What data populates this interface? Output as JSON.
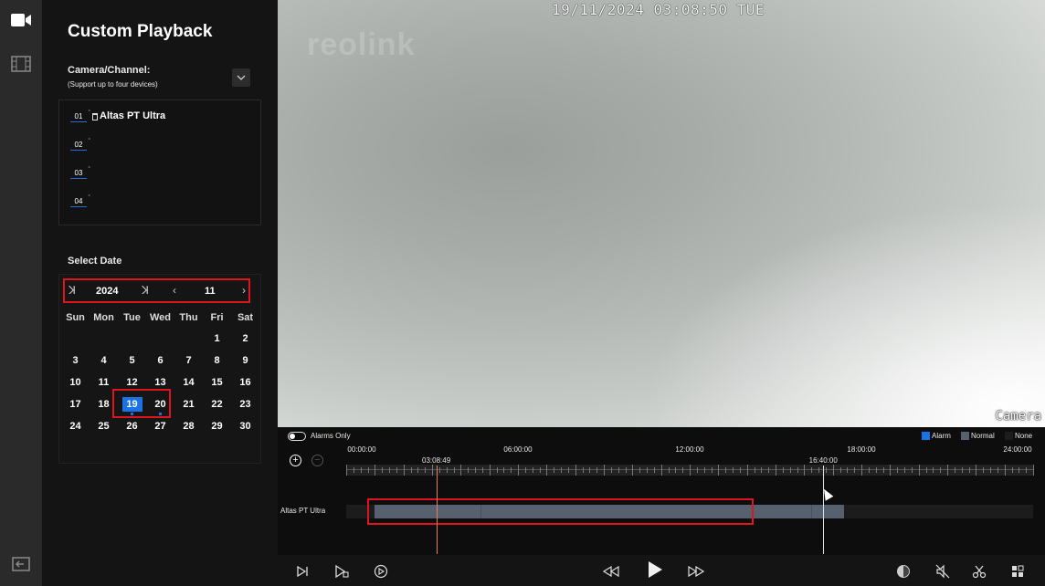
{
  "panel": {
    "title": "Custom Playback",
    "camera_label": "Camera/Channel:",
    "camera_sublabel": "(Support up to four devices)",
    "channels": [
      {
        "num": "01",
        "name": "Altas PT Ultra"
      },
      {
        "num": "02",
        "name": ""
      },
      {
        "num": "03",
        "name": ""
      },
      {
        "num": "04",
        "name": ""
      }
    ],
    "date_label": "Select Date"
  },
  "calendar": {
    "year": "2024",
    "month": "11",
    "weekdays": [
      "Sun",
      "Mon",
      "Tue",
      "Wed",
      "Thu",
      "Fri",
      "Sat"
    ],
    "weeks": [
      [
        "",
        "",
        "",
        "",
        "",
        "1",
        "2"
      ],
      [
        "3",
        "4",
        "5",
        "6",
        "7",
        "8",
        "9"
      ],
      [
        "10",
        "11",
        "12",
        "13",
        "14",
        "15",
        "16"
      ],
      [
        "17",
        "18",
        "19",
        "20",
        "21",
        "22",
        "23"
      ],
      [
        "24",
        "25",
        "26",
        "27",
        "28",
        "29",
        "30"
      ]
    ],
    "selected_day": "19",
    "days_with_recordings": [
      "19",
      "20"
    ]
  },
  "video": {
    "timestamp": "19/11/2024 03:08:50 TUE",
    "watermark": "reolink",
    "camera_overlay": "Camera"
  },
  "timeline": {
    "alarms_only_label": "Alarms Only",
    "legend": [
      {
        "label": "Alarm",
        "color": "#1a72e6"
      },
      {
        "label": "Normal",
        "color": "#56606e"
      },
      {
        "label": "None",
        "color": "#1c1c1c"
      }
    ],
    "hour_labels": [
      "00:00:00",
      "06:00:00",
      "12:00:00",
      "18:00:00",
      "24:00:00"
    ],
    "playhead_time": "03:08:49",
    "hover_time": "16:40:00",
    "track_name": "Altas PT Ultra",
    "recording_span_hours": [
      1.0,
      17.4
    ]
  },
  "controls": {
    "icons": [
      "next-frame-icon",
      "clip-play-icon",
      "speed-icon",
      "rewind-icon",
      "play-icon",
      "fast-forward-icon",
      "sync-icon",
      "mute-icon",
      "cut-icon",
      "layout-icon"
    ]
  }
}
